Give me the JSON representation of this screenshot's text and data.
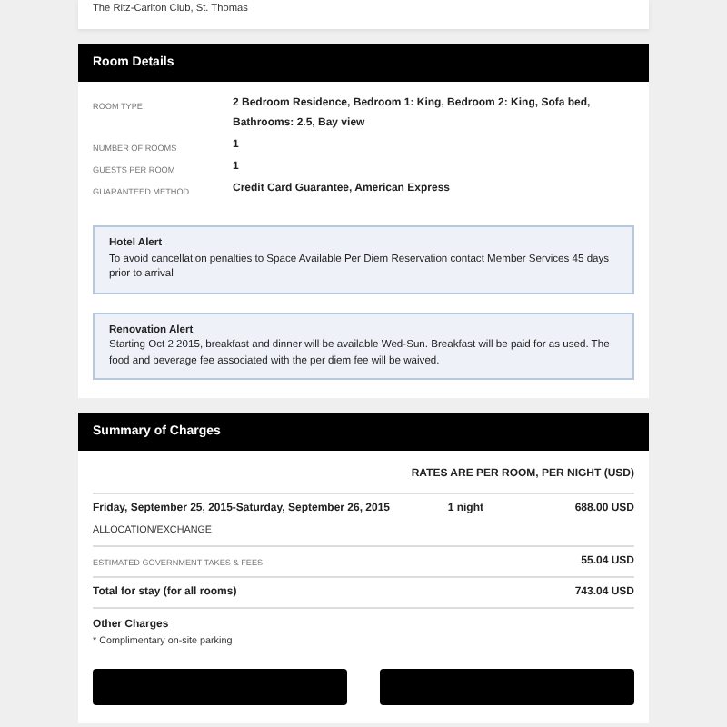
{
  "hotel": {
    "name": "The Ritz-Carlton Club, St. Thomas"
  },
  "room_details": {
    "title": "Room Details",
    "rows": [
      {
        "label": "ROOM TYPE",
        "value": "2 Bedroom Residence, Bedroom 1: King, Bedroom 2: King, Sofa bed, Bathrooms: 2.5, Bay view"
      },
      {
        "label": "NUMBER OF ROOMS",
        "value": "1"
      },
      {
        "label": "GUESTS PER ROOM",
        "value": "1"
      },
      {
        "label": "GUARANTEED METHOD",
        "value": "Credit Card Guarantee, American Express"
      }
    ],
    "alerts": [
      {
        "title": "Hotel Alert",
        "text": "To avoid cancellation penalties to Space Available Per Diem Reservation contact Member Services 45 days prior to arrival"
      },
      {
        "title": "Renovation Alert",
        "text": "Starting Oct 2 2015, breakfast and dinner will be available Wed-Sun. Breakfast will be paid for as used. The food and beverage fee associated with the per diem fee will be waived."
      }
    ]
  },
  "summary": {
    "title": "Summary of Charges",
    "rates_note": "RATES ARE PER ROOM, PER NIGHT (USD)",
    "stay": {
      "dates": "Friday, September 25, 2015-Saturday, September 26, 2015",
      "nights": "1 night",
      "amount": "688.00 USD",
      "rate_type": "ALLOCATION/EXCHANGE"
    },
    "taxes": {
      "label": "ESTIMATED GOVERNMENT TAKES & FEES",
      "amount": "55.04 USD"
    },
    "total": {
      "label": "Total for stay (for all rooms)",
      "amount": "743.04 USD"
    },
    "other_charges": {
      "title": "Other Charges",
      "items": [
        "* Complimentary on-site parking"
      ]
    }
  }
}
